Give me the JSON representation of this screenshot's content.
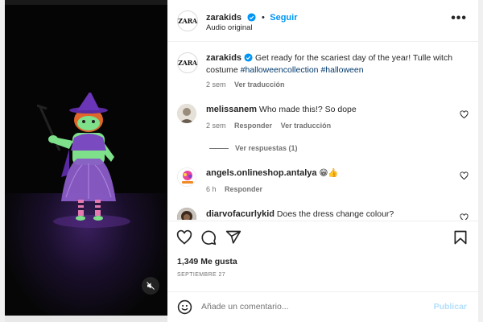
{
  "post": {
    "username": "zarakids",
    "follow_label": "Seguir",
    "audio": "Audio original",
    "more_label": "•••"
  },
  "caption": {
    "username": "zarakids",
    "text": "Get ready for the scariest day of the year! Tulle witch costume",
    "hashtags": [
      "#halloweencollection",
      "#halloween"
    ],
    "time": "2 sem",
    "translate": "Ver traducción"
  },
  "comments": [
    {
      "username": "melissanem",
      "text": "Who made this!? So dope",
      "time": "2 sem",
      "reply": "Responder",
      "translate": "Ver traducción",
      "replies_label": "Ver respuestas (1)"
    },
    {
      "username": "angels.onlineshop.antalya",
      "text": "😁👍",
      "time": "6 h",
      "reply": "Responder"
    },
    {
      "username": "diarvofacurlykid",
      "text": "Does the dress change colour?"
    }
  ],
  "engagement": {
    "likes": "1,349 Me gusta",
    "date": "SEPTIEMBRE 27"
  },
  "composer": {
    "placeholder": "Añade un comentario...",
    "publish": "Publicar"
  },
  "avatar_logo_text": "ZARA",
  "colors": {
    "accent": "#0095f6",
    "hashtag": "#00376b",
    "muted": "#737373",
    "publish_disabled": "#b2dffc",
    "witch_skin": "#7ee08a",
    "witch_dress": "#8a5cc7"
  },
  "icons": [
    "verified-icon",
    "more-icon",
    "heart-icon",
    "comment-icon",
    "share-icon",
    "bookmark-icon",
    "emoji-icon",
    "mute-icon"
  ]
}
